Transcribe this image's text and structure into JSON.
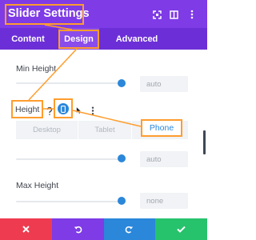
{
  "header": {
    "title": "Slider Settings",
    "icons": [
      "expand-icon",
      "split-view-icon",
      "more-options-icon"
    ]
  },
  "tabs": [
    {
      "label": "Content",
      "active": false
    },
    {
      "label": "Design",
      "active": true
    },
    {
      "label": "Advanced",
      "active": false
    }
  ],
  "settings": {
    "min_height": {
      "label": "Min Height",
      "value": "auto"
    },
    "height": {
      "label": "Height",
      "devices": [
        "Desktop",
        "Tablet",
        "Phone"
      ],
      "value": "auto"
    },
    "max_height": {
      "label": "Max Height",
      "value": "none"
    }
  },
  "footer": {
    "buttons": [
      {
        "name": "cancel",
        "icon": "close-icon",
        "color": "#ef3b4f"
      },
      {
        "name": "undo",
        "icon": "undo-icon",
        "color": "#7e3be6"
      },
      {
        "name": "redo",
        "icon": "redo-icon",
        "color": "#2b87da"
      },
      {
        "name": "save",
        "icon": "check-icon",
        "color": "#27c26c"
      }
    ]
  },
  "colors": {
    "header": "#7e3be6",
    "tabs": "#6c2fd7",
    "accent": "#2b87da",
    "highlight": "#ff9d2e"
  }
}
